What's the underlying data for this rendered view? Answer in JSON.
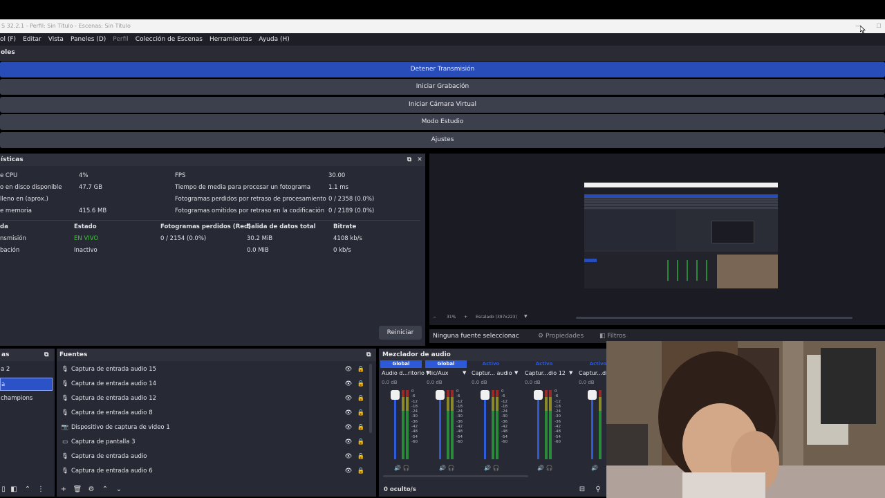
{
  "window": {
    "title": "S 32.2.1 - Perfil: Sin Título - Escenas: Sin Título",
    "minimize": "—",
    "maximize": "☐"
  },
  "menu": {
    "items": [
      "ol (F)",
      "Editar",
      "Vista",
      "Paneles (D)",
      "Perfil",
      "Colección de Escenas",
      "Herramientas",
      "Ayuda (H)"
    ]
  },
  "controls": {
    "header": "oles",
    "buttons": [
      "Detener Transmisión",
      "Iniciar Grabación",
      "Iniciar Cámara Virtual",
      "Modo Estudio",
      "Ajustes"
    ]
  },
  "stats": {
    "header": "ísticas",
    "left_labels": [
      "e CPU",
      "o en disco disponible",
      "lleno en (aprox.)",
      "e memoria"
    ],
    "left_values": [
      "4%",
      "47.7 GB",
      "",
      "415.6 MB"
    ],
    "right_labels": [
      "FPS",
      "Tiempo de media para procesar un fotograma",
      "Fotogramas perdidos por retraso de procesamiento",
      "Fotogramas omitidos por retraso en la codificación"
    ],
    "right_values": [
      "30.00",
      "1.1 ms",
      "0 / 2358 (0.0%)",
      "0 / 2189 (0.0%)"
    ],
    "table_headers": [
      "da",
      "Estado",
      "Fotogramas perdidos (Red)",
      "Salida de datos total",
      "Bitrate"
    ],
    "row1": [
      "nsmisión",
      "EN VIVO",
      "0 / 2154 (0.0%)",
      "30.2 MiB",
      "4108 kb/s"
    ],
    "row2": [
      "bación",
      "Inactivo",
      "",
      "0.0 MiB",
      "0 kb/s"
    ],
    "reset": "Reiniciar"
  },
  "preview": {
    "zoom": "31%",
    "scale_text": "Escalado (397x223)"
  },
  "properties_bar": {
    "no_source": "Ninguna fuente seleccionac",
    "properties": "Propiedades",
    "filters": "Filtros"
  },
  "scenes": {
    "header": "as",
    "items": [
      "a 2",
      "a",
      "champions"
    ]
  },
  "sources": {
    "header": "Fuentes",
    "items": [
      {
        "label": "Captura de entrada audio 15",
        "icon": "mic"
      },
      {
        "label": "Captura de entrada audio 14",
        "icon": "mic"
      },
      {
        "label": "Captura de entrada audio 12",
        "icon": "mic"
      },
      {
        "label": "Captura de entrada audio 8",
        "icon": "mic"
      },
      {
        "label": "Dispositivo de captura de video 1",
        "icon": "camera"
      },
      {
        "label": "Captura de pantalla 3",
        "icon": "monitor"
      },
      {
        "label": "Captura de entrada audio",
        "icon": "mic"
      },
      {
        "label": "Captura de entrada audio 6",
        "icon": "mic"
      }
    ]
  },
  "mixer": {
    "header": "Mezclador de audio",
    "hidden": "0 oculto/s",
    "channels": [
      {
        "badge": "Global",
        "name": "Audio d...ritorio",
        "db": "0.0 dB"
      },
      {
        "badge": "Global",
        "name": "Mic/Aux",
        "db": "0.0 dB"
      },
      {
        "badge": "Activo",
        "name": "Captur... audio",
        "db": "0.0 dB"
      },
      {
        "badge": "Activo",
        "name": "Captur...dio 12",
        "db": "0.0 dB"
      },
      {
        "badge": "Activo",
        "name": "Captur...di",
        "db": "0.0 dB"
      }
    ],
    "scale": [
      "0",
      "-6",
      "-12",
      "-18",
      "-24",
      "-30",
      "-36",
      "-42",
      "-48",
      "-54",
      "-60"
    ]
  },
  "colors": {
    "accent": "#284cb8",
    "live": "#48c040",
    "panel": "#272934",
    "button": "#3c404d"
  }
}
